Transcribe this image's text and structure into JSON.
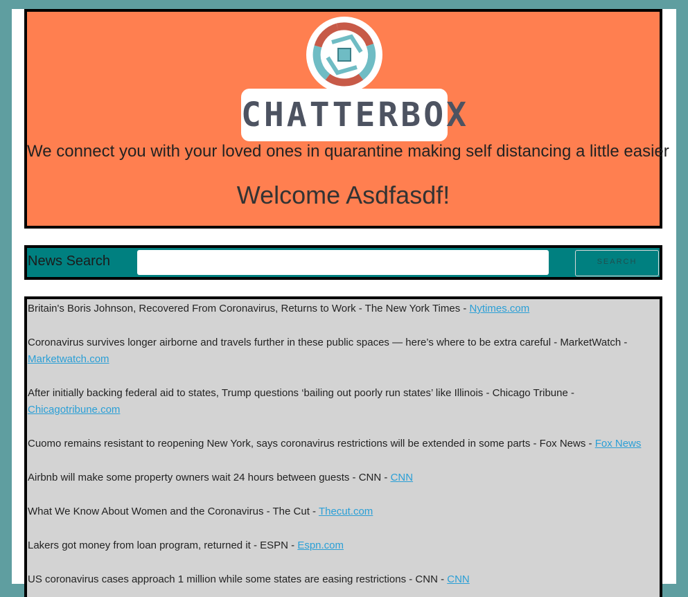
{
  "header": {
    "brand": "CHATTERBOX",
    "tagline": "We connect you with your loved ones in quarantine making self distancing a little easier",
    "welcome": "Welcome Asdfasdf!"
  },
  "search": {
    "label": "News Search",
    "value": "",
    "button_label": "SEARCH"
  },
  "news": [
    {
      "text": "Britain's Boris Johnson, Recovered From Coronavirus, Returns to Work - The New York Times - ",
      "link": "Nytimes.com"
    },
    {
      "text": "Coronavirus survives longer airborne and travels further in these public spaces — here’s where to be extra careful - MarketWatch - ",
      "link": "Marketwatch.com"
    },
    {
      "text": "After initially backing federal aid to states, Trump questions ‘bailing out poorly run states’ like Illinois - Chicago Tribune - ",
      "link": "Chicagotribune.com"
    },
    {
      "text": "Cuomo remains resistant to reopening New York, says coronavirus restrictions will be extended in some parts - Fox News - ",
      "link": "Fox News"
    },
    {
      "text": "Airbnb will make some property owners wait 24 hours between guests - CNN - ",
      "link": "CNN"
    },
    {
      "text": "What We Know About Women and the Coronavirus - The Cut - ",
      "link": "Thecut.com"
    },
    {
      "text": "Lakers got money from loan program, returned it - ESPN - ",
      "link": "Espn.com"
    },
    {
      "text": "US coronavirus cases approach 1 million while some states are easing restrictions - CNN - ",
      "link": "CNN"
    }
  ],
  "colors": {
    "background": "#5f9ea0",
    "hero": "#ff7f50",
    "searchbar": "#008080",
    "news_panel": "#d3d3d3",
    "link": "#2a9fd6"
  },
  "icons": {
    "logo": "chatterbox-aperture-logo"
  }
}
